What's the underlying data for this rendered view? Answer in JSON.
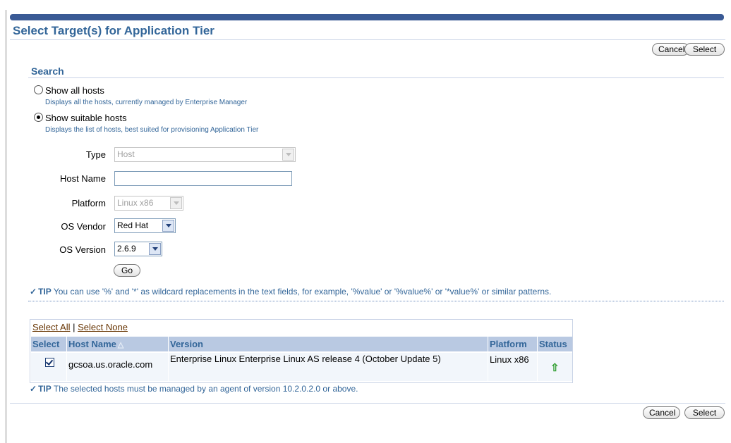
{
  "page": {
    "title": "Select Target(s) for Application Tier",
    "cancel_label": "Cancel",
    "select_label": "Select"
  },
  "search": {
    "heading": "Search",
    "options": [
      {
        "label": "Show all hosts",
        "hint": "Displays all the hosts, currently managed by Enterprise Manager",
        "selected": false
      },
      {
        "label": "Show suitable hosts",
        "hint": "Displays the list of hosts, best suited for provisioning Application Tier",
        "selected": true
      }
    ],
    "fields": {
      "type_label": "Type",
      "type_value": "Host",
      "host_name_label": "Host Name",
      "host_name_value": "",
      "platform_label": "Platform",
      "platform_value": "Linux x86",
      "os_vendor_label": "OS Vendor",
      "os_vendor_value": "Red Hat",
      "os_version_label": "OS Version",
      "os_version_value": "2.6.9"
    },
    "go_label": "Go"
  },
  "tips": {
    "tip_word": "TIP",
    "wildcard": "You can use '%' and '*' as wildcard replacements in the text fields, for example, '%value' or '%value%' or '*value%' or similar patterns.",
    "agent": "The selected hosts must be managed by an agent of version 10.2.0.2.0 or above."
  },
  "table": {
    "select_all": "Select All",
    "separator": "|",
    "select_none": "Select None",
    "columns": [
      "Select",
      "Host Name",
      "Version",
      "Platform",
      "Status"
    ],
    "sort_icon": "triangle-up-icon",
    "rows": [
      {
        "selected": true,
        "host_name": "gcsoa.us.oracle.com",
        "version": "Enterprise Linux Enterprise Linux AS release 4 (October Update 5)",
        "platform": "Linux x86",
        "status_icon": "up-arrow-icon"
      }
    ]
  },
  "colors": {
    "accent": "#336699",
    "header_bg": "#b9c9e2",
    "topbar": "#3a5a95",
    "status_up": "#2f9e2f"
  }
}
